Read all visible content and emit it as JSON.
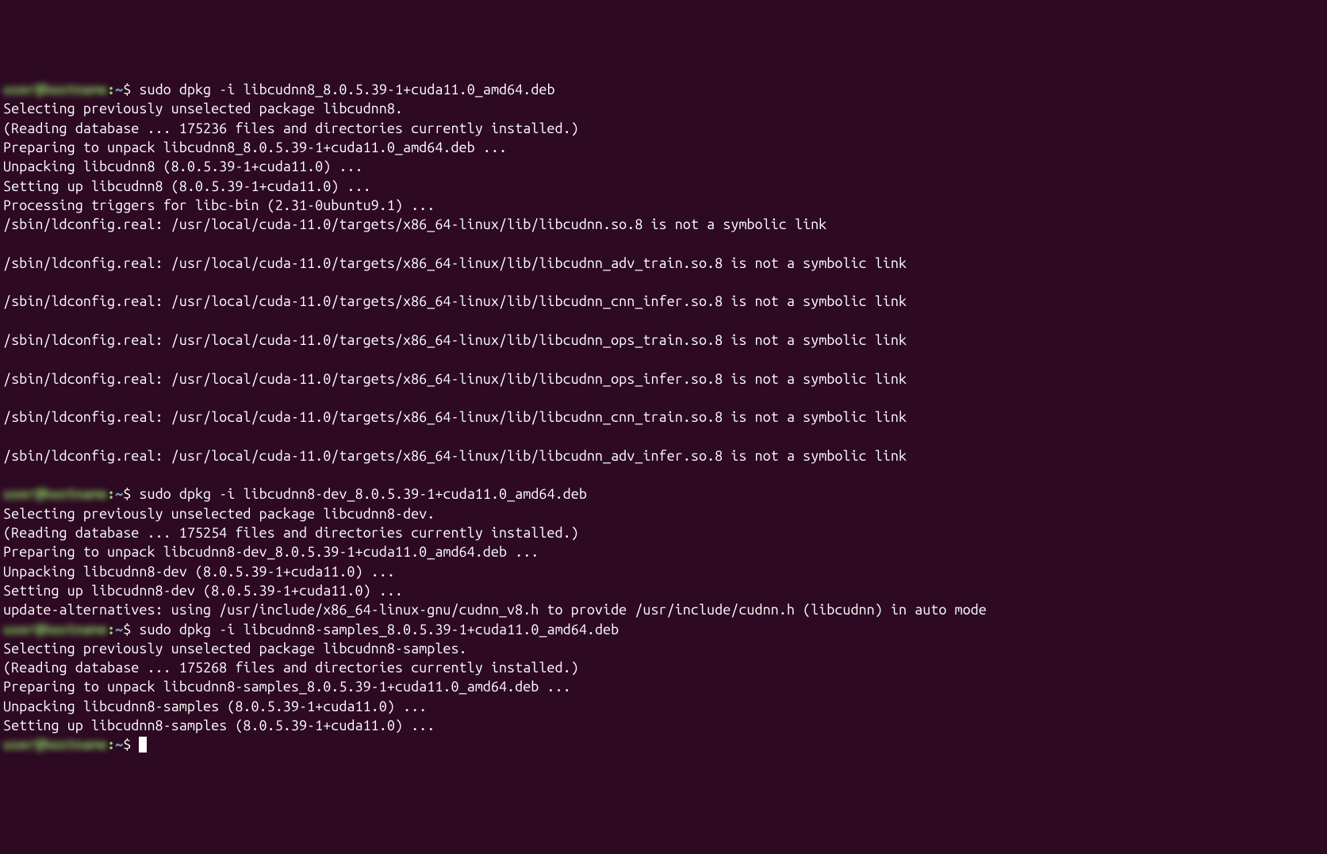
{
  "prompts": {
    "user_host_redacted": "user@hostname",
    "path": "~",
    "separator": ":",
    "dollar": "$"
  },
  "commands": {
    "cmd1": "sudo dpkg -i libcudnn8_8.0.5.39-1+cuda11.0_amd64.deb",
    "cmd2": "sudo dpkg -i libcudnn8-dev_8.0.5.39-1+cuda11.0_amd64.deb",
    "cmd3": "sudo dpkg -i libcudnn8-samples_8.0.5.39-1+cuda11.0_amd64.deb"
  },
  "output1": {
    "l1": "Selecting previously unselected package libcudnn8.",
    "l2": "(Reading database ... 175236 files and directories currently installed.)",
    "l3": "Preparing to unpack libcudnn8_8.0.5.39-1+cuda11.0_amd64.deb ...",
    "l4": "Unpacking libcudnn8 (8.0.5.39-1+cuda11.0) ...",
    "l5": "Setting up libcudnn8 (8.0.5.39-1+cuda11.0) ...",
    "l6": "Processing triggers for libc-bin (2.31-0ubuntu9.1) ...",
    "l7": "/sbin/ldconfig.real: /usr/local/cuda-11.0/targets/x86_64-linux/lib/libcudnn.so.8 is not a symbolic link",
    "l8": "",
    "l9": "/sbin/ldconfig.real: /usr/local/cuda-11.0/targets/x86_64-linux/lib/libcudnn_adv_train.so.8 is not a symbolic link",
    "l10": "",
    "l11": "/sbin/ldconfig.real: /usr/local/cuda-11.0/targets/x86_64-linux/lib/libcudnn_cnn_infer.so.8 is not a symbolic link",
    "l12": "",
    "l13": "/sbin/ldconfig.real: /usr/local/cuda-11.0/targets/x86_64-linux/lib/libcudnn_ops_train.so.8 is not a symbolic link",
    "l14": "",
    "l15": "/sbin/ldconfig.real: /usr/local/cuda-11.0/targets/x86_64-linux/lib/libcudnn_ops_infer.so.8 is not a symbolic link",
    "l16": "",
    "l17": "/sbin/ldconfig.real: /usr/local/cuda-11.0/targets/x86_64-linux/lib/libcudnn_cnn_train.so.8 is not a symbolic link",
    "l18": "",
    "l19": "/sbin/ldconfig.real: /usr/local/cuda-11.0/targets/x86_64-linux/lib/libcudnn_adv_infer.so.8 is not a symbolic link",
    "l20": ""
  },
  "output2": {
    "l1": "Selecting previously unselected package libcudnn8-dev.",
    "l2": "(Reading database ... 175254 files and directories currently installed.)",
    "l3": "Preparing to unpack libcudnn8-dev_8.0.5.39-1+cuda11.0_amd64.deb ...",
    "l4": "Unpacking libcudnn8-dev (8.0.5.39-1+cuda11.0) ...",
    "l5": "Setting up libcudnn8-dev (8.0.5.39-1+cuda11.0) ...",
    "l6": "update-alternatives: using /usr/include/x86_64-linux-gnu/cudnn_v8.h to provide /usr/include/cudnn.h (libcudnn) in auto mode"
  },
  "output3": {
    "l1": "Selecting previously unselected package libcudnn8-samples.",
    "l2": "(Reading database ... 175268 files and directories currently installed.)",
    "l3": "Preparing to unpack libcudnn8-samples_8.0.5.39-1+cuda11.0_amd64.deb ...",
    "l4": "Unpacking libcudnn8-samples (8.0.5.39-1+cuda11.0) ...",
    "l5": "Setting up libcudnn8-samples (8.0.5.39-1+cuda11.0) ..."
  }
}
